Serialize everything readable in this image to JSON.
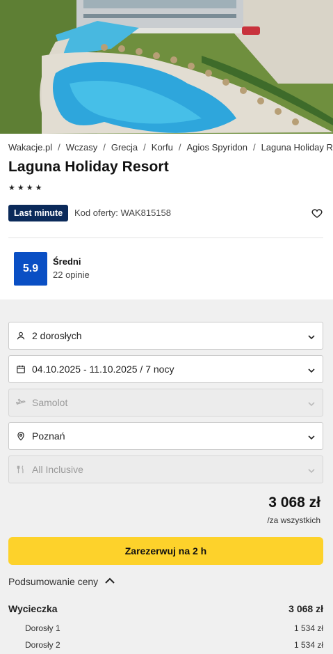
{
  "breadcrumbs": [
    "Wakacje.pl",
    "Wczasy",
    "Grecja",
    "Korfu",
    "Agios Spyridon",
    "Laguna Holiday Resort"
  ],
  "hotel": {
    "name": "Laguna Holiday Resort",
    "stars": 4,
    "badge": "Last minute",
    "offer_code": "Kod oferty: WAK815158"
  },
  "rating": {
    "score": "5.9",
    "label": "Średni",
    "count": "22 opinie"
  },
  "form": {
    "travelers": "2 dorosłych",
    "dates": "04.10.2025 - 11.10.2025 / 7 nocy",
    "transport": "Samolot",
    "departure": "Poznań",
    "board": "All Inclusive"
  },
  "price": {
    "total": "3 068 zł",
    "note": "/za wszystkich"
  },
  "book_button": "Zarezerwuj na 2 h",
  "summary": {
    "toggle_label": "Podsumowanie ceny",
    "trip_label": "Wycieczka",
    "trip_price": "3 068 zł",
    "adult1_label": "Dorosły 1",
    "adult1_price": "1 534 zł",
    "adult2_label": "Dorosły 2",
    "adult2_price": "1 534 zł"
  },
  "colors": {
    "badge": "#0b2a5a",
    "rating": "#0a4fc4",
    "book_button": "#fdd22b",
    "panel": "#f0f0f0"
  }
}
